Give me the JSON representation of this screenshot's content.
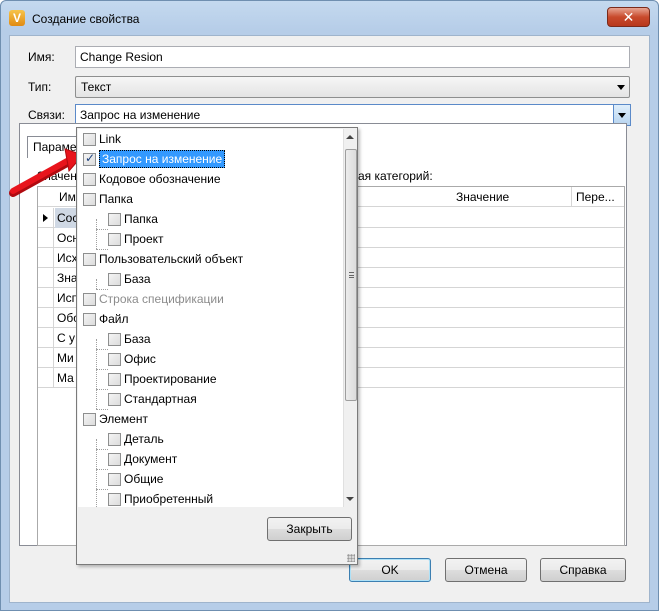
{
  "window": {
    "title": "Создание свойства",
    "close_glyph": "✕",
    "app_icon_letter": "V"
  },
  "form": {
    "name_label": "Имя:",
    "name_value": "Change Resion",
    "type_label": "Тип:",
    "type_value": "Текст",
    "links_label": "Связи:",
    "links_value": "Запрос на изменение"
  },
  "tab": {
    "label": "Парамет"
  },
  "panel": {
    "caption_left": "Значени",
    "caption_right": "ая категорий:"
  },
  "grid": {
    "columns": [
      "Им",
      "Значение",
      "Пере..."
    ],
    "rows": [
      "Сос",
      "Осн",
      "Исх",
      "Зна",
      "Исп",
      "Обо",
      "С у",
      "Ми",
      "Ма"
    ]
  },
  "popup": {
    "close_label": "Закрыть",
    "tree": [
      {
        "label": "Link",
        "level": 0,
        "checked": false
      },
      {
        "label": "Запрос на изменение",
        "level": 0,
        "checked": true,
        "selected": true
      },
      {
        "label": "Кодовое обозначение",
        "level": 0,
        "checked": false
      },
      {
        "label": "Папка",
        "level": 0,
        "checked": false
      },
      {
        "label": "Папка",
        "level": 1,
        "checked": false
      },
      {
        "label": "Проект",
        "level": 1,
        "checked": false
      },
      {
        "label": "Пользовательский объект",
        "level": 0,
        "checked": false
      },
      {
        "label": "База",
        "level": 1,
        "checked": false
      },
      {
        "label": "Строка спецификации",
        "level": 0,
        "checked": false,
        "disabled": true
      },
      {
        "label": "Файл",
        "level": 0,
        "checked": false
      },
      {
        "label": "База",
        "level": 1,
        "checked": false
      },
      {
        "label": "Офис",
        "level": 1,
        "checked": false
      },
      {
        "label": "Проектирование",
        "level": 1,
        "checked": false
      },
      {
        "label": "Стандартная",
        "level": 1,
        "checked": false
      },
      {
        "label": "Элемент",
        "level": 0,
        "checked": false
      },
      {
        "label": "Деталь",
        "level": 1,
        "checked": false
      },
      {
        "label": "Документ",
        "level": 1,
        "checked": false
      },
      {
        "label": "Общие",
        "level": 1,
        "checked": false
      },
      {
        "label": "Приобретенный",
        "level": 1,
        "checked": false
      }
    ]
  },
  "buttons": {
    "ok": "OK",
    "cancel": "Отмена",
    "help": "Справка"
  },
  "colors": {
    "selection": "#3399ff",
    "annotation_arrow": "#e8141c"
  }
}
